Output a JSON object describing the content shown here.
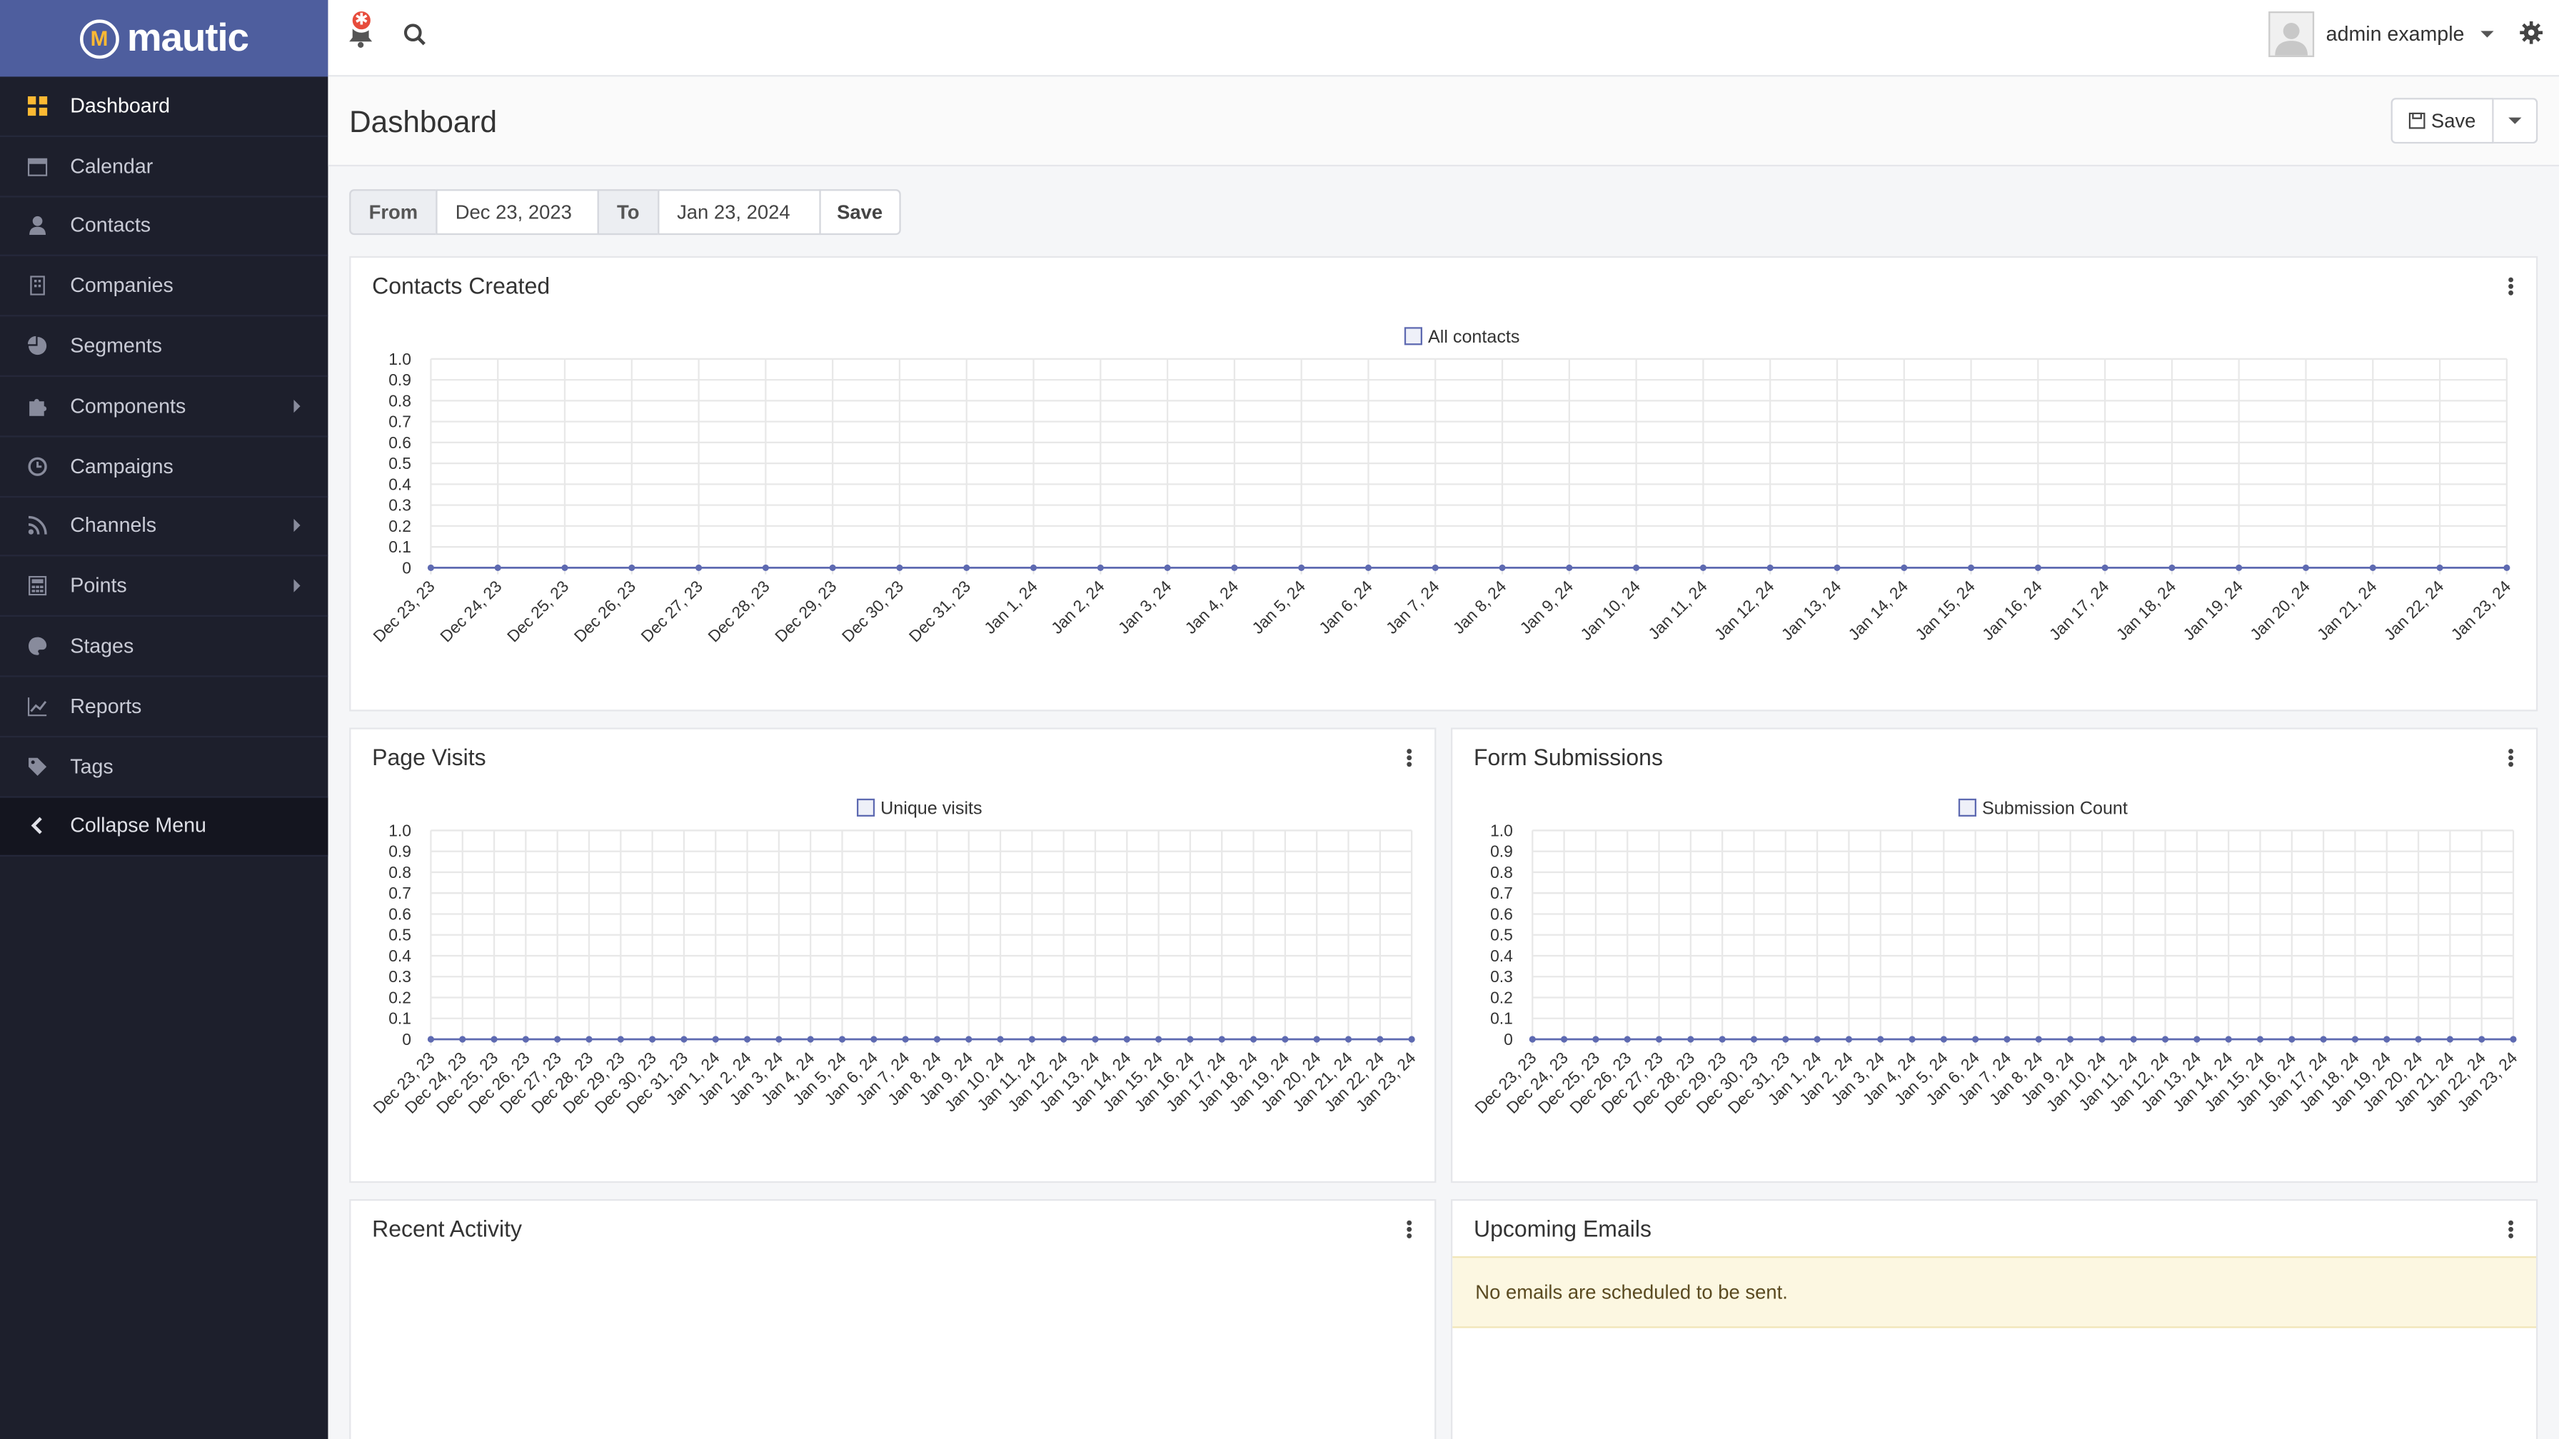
{
  "brand": {
    "name": "mautic",
    "logo_letter": "M"
  },
  "sidebar": {
    "items": [
      {
        "label": "Dashboard",
        "icon": "grid-icon",
        "active": true,
        "submenu": false
      },
      {
        "label": "Calendar",
        "icon": "calendar-icon",
        "active": false,
        "submenu": false
      },
      {
        "label": "Contacts",
        "icon": "user-icon",
        "active": false,
        "submenu": false
      },
      {
        "label": "Companies",
        "icon": "building-icon",
        "active": false,
        "submenu": false
      },
      {
        "label": "Segments",
        "icon": "pie-chart-icon",
        "active": false,
        "submenu": false
      },
      {
        "label": "Components",
        "icon": "puzzle-icon",
        "active": false,
        "submenu": true
      },
      {
        "label": "Campaigns",
        "icon": "clock-icon",
        "active": false,
        "submenu": false
      },
      {
        "label": "Channels",
        "icon": "rss-icon",
        "active": false,
        "submenu": true
      },
      {
        "label": "Points",
        "icon": "calculator-icon",
        "active": false,
        "submenu": true
      },
      {
        "label": "Stages",
        "icon": "palette-icon",
        "active": false,
        "submenu": false
      },
      {
        "label": "Reports",
        "icon": "line-chart-icon",
        "active": false,
        "submenu": false
      },
      {
        "label": "Tags",
        "icon": "tag-icon",
        "active": false,
        "submenu": false
      }
    ],
    "collapse_label": "Collapse Menu"
  },
  "header": {
    "notification_badge": "✱",
    "user_name": "admin example"
  },
  "page": {
    "title": "Dashboard",
    "save_label": "Save"
  },
  "filter": {
    "from_label": "From",
    "from_value": "Dec 23, 2023",
    "to_label": "To",
    "to_value": "Jan 23, 2024",
    "save_label": "Save"
  },
  "widgets": {
    "contacts_title": "Contacts Created",
    "visits_title": "Page Visits",
    "forms_title": "Form Submissions",
    "activity_title": "Recent Activity",
    "emails_title": "Upcoming Emails",
    "emails_empty": "No emails are scheduled to be sent."
  },
  "colors": {
    "brand": "#4e5e9e",
    "sidebar": "#1d1f2c",
    "accent": "#fdb933",
    "series": "#5e6ab1"
  },
  "chart_data": [
    {
      "type": "line",
      "title": "Contacts Created",
      "categories": [
        "Dec 23, 23",
        "Dec 24, 23",
        "Dec 25, 23",
        "Dec 26, 23",
        "Dec 27, 23",
        "Dec 28, 23",
        "Dec 29, 23",
        "Dec 30, 23",
        "Dec 31, 23",
        "Jan 1, 24",
        "Jan 2, 24",
        "Jan 3, 24",
        "Jan 4, 24",
        "Jan 5, 24",
        "Jan 6, 24",
        "Jan 7, 24",
        "Jan 8, 24",
        "Jan 9, 24",
        "Jan 10, 24",
        "Jan 11, 24",
        "Jan 12, 24",
        "Jan 13, 24",
        "Jan 14, 24",
        "Jan 15, 24",
        "Jan 16, 24",
        "Jan 17, 24",
        "Jan 18, 24",
        "Jan 19, 24",
        "Jan 20, 24",
        "Jan 21, 24",
        "Jan 22, 24",
        "Jan 23, 24"
      ],
      "series": [
        {
          "name": "All contacts",
          "values": [
            0,
            0,
            0,
            0,
            0,
            0,
            0,
            0,
            0,
            0,
            0,
            0,
            0,
            0,
            0,
            0,
            0,
            0,
            0,
            0,
            0,
            0,
            0,
            0,
            0,
            0,
            0,
            0,
            0,
            0,
            0,
            0
          ]
        }
      ],
      "yticks": [
        "0",
        "0.1",
        "0.2",
        "0.3",
        "0.4",
        "0.5",
        "0.6",
        "0.7",
        "0.8",
        "0.9",
        "1.0"
      ],
      "ylim": [
        0,
        1
      ],
      "grid": true,
      "legend": "top-center"
    },
    {
      "type": "line",
      "title": "Page Visits",
      "categories": [
        "Dec 23, 23",
        "Dec 24, 23",
        "Dec 25, 23",
        "Dec 26, 23",
        "Dec 27, 23",
        "Dec 28, 23",
        "Dec 29, 23",
        "Dec 30, 23",
        "Dec 31, 23",
        "Jan 1, 24",
        "Jan 2, 24",
        "Jan 3, 24",
        "Jan 4, 24",
        "Jan 5, 24",
        "Jan 6, 24",
        "Jan 7, 24",
        "Jan 8, 24",
        "Jan 9, 24",
        "Jan 10, 24",
        "Jan 11, 24",
        "Jan 12, 24",
        "Jan 13, 24",
        "Jan 14, 24",
        "Jan 15, 24",
        "Jan 16, 24",
        "Jan 17, 24",
        "Jan 18, 24",
        "Jan 19, 24",
        "Jan 20, 24",
        "Jan 21, 24",
        "Jan 22, 24",
        "Jan 23, 24"
      ],
      "series": [
        {
          "name": "Unique visits",
          "values": [
            0,
            0,
            0,
            0,
            0,
            0,
            0,
            0,
            0,
            0,
            0,
            0,
            0,
            0,
            0,
            0,
            0,
            0,
            0,
            0,
            0,
            0,
            0,
            0,
            0,
            0,
            0,
            0,
            0,
            0,
            0,
            0
          ]
        }
      ],
      "yticks": [
        "0",
        "0.1",
        "0.2",
        "0.3",
        "0.4",
        "0.5",
        "0.6",
        "0.7",
        "0.8",
        "0.9",
        "1.0"
      ],
      "ylim": [
        0,
        1
      ],
      "grid": true,
      "legend": "top-center"
    },
    {
      "type": "line",
      "title": "Form Submissions",
      "categories": [
        "Dec 23, 23",
        "Dec 24, 23",
        "Dec 25, 23",
        "Dec 26, 23",
        "Dec 27, 23",
        "Dec 28, 23",
        "Dec 29, 23",
        "Dec 30, 23",
        "Dec 31, 23",
        "Jan 1, 24",
        "Jan 2, 24",
        "Jan 3, 24",
        "Jan 4, 24",
        "Jan 5, 24",
        "Jan 6, 24",
        "Jan 7, 24",
        "Jan 8, 24",
        "Jan 9, 24",
        "Jan 10, 24",
        "Jan 11, 24",
        "Jan 12, 24",
        "Jan 13, 24",
        "Jan 14, 24",
        "Jan 15, 24",
        "Jan 16, 24",
        "Jan 17, 24",
        "Jan 18, 24",
        "Jan 19, 24",
        "Jan 20, 24",
        "Jan 21, 24",
        "Jan 22, 24",
        "Jan 23, 24"
      ],
      "series": [
        {
          "name": "Submission Count",
          "values": [
            0,
            0,
            0,
            0,
            0,
            0,
            0,
            0,
            0,
            0,
            0,
            0,
            0,
            0,
            0,
            0,
            0,
            0,
            0,
            0,
            0,
            0,
            0,
            0,
            0,
            0,
            0,
            0,
            0,
            0,
            0,
            0
          ]
        }
      ],
      "yticks": [
        "0",
        "0.1",
        "0.2",
        "0.3",
        "0.4",
        "0.5",
        "0.6",
        "0.7",
        "0.8",
        "0.9",
        "1.0"
      ],
      "ylim": [
        0,
        1
      ],
      "grid": true,
      "legend": "top-center"
    }
  ]
}
